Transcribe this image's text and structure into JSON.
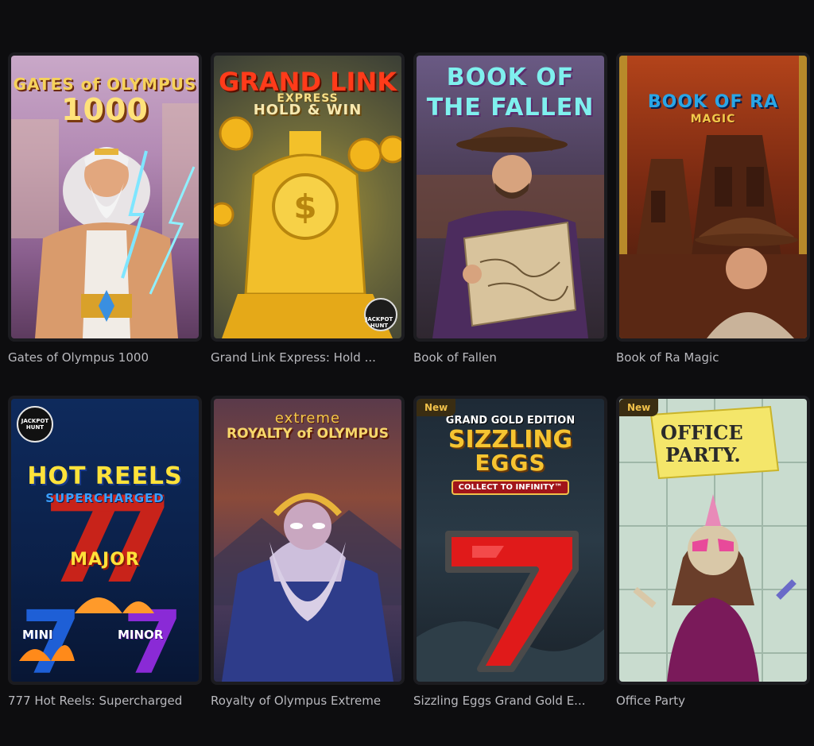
{
  "games": [
    {
      "title": "Gates of Olympus 1000",
      "logo_line1": "GATES of OLYMPUS",
      "logo_line2": "1000"
    },
    {
      "title": "Grand Link Express: Hold ...",
      "logo_line1": "GRAND LINK",
      "logo_line2": "EXPRESS",
      "logo_line3": "HOLD & WIN",
      "corner_badge": "JACKPOT HUNT"
    },
    {
      "title": "Book of Fallen",
      "logo_line1": "BOOK OF",
      "logo_line2": "THE FALLEN"
    },
    {
      "title": "Book of Ra Magic",
      "logo_line1": "BOOK OF RA",
      "logo_line2": "MAGIC"
    },
    {
      "title": "777 Hot Reels: Supercharged",
      "logo_line1": "HOT REELS",
      "logo_line2": "SUPERCHARGED",
      "label_major": "MAJOR",
      "label_mini": "MINI",
      "label_minor": "MINOR",
      "corner_badge": "JACKPOT HUNT"
    },
    {
      "title": "Royalty of Olympus Extreme",
      "logo_line1": "extreme",
      "logo_line2": "ROYALTY of OLYMPUS"
    },
    {
      "title": "Sizzling Eggs Grand Gold E...",
      "badge": "New",
      "logo_line1": "GRAND GOLD EDITION",
      "logo_line2": "SIZZLING",
      "logo_line3": "EGGS",
      "tagline": "COLLECT TO INFINITY™"
    },
    {
      "title": "Office Party",
      "badge": "New",
      "logo_line1": "OFFICE",
      "logo_line2": "PARTY."
    }
  ]
}
